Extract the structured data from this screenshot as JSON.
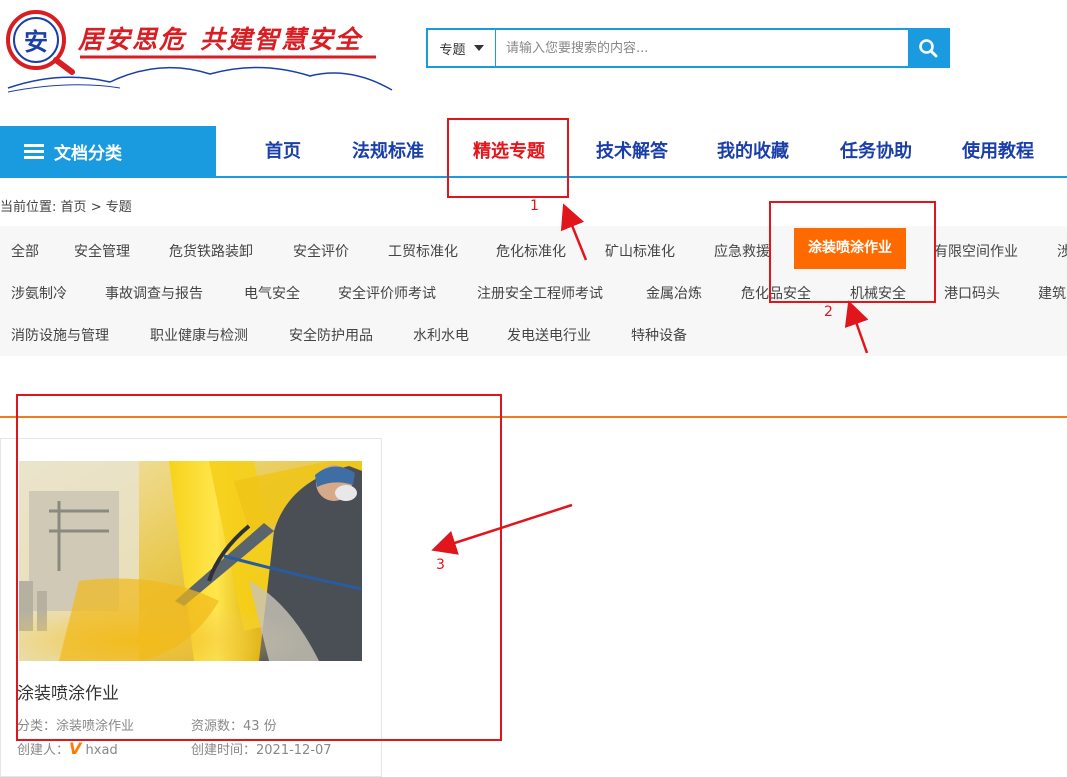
{
  "logo": {
    "seal_char": "安",
    "slogan_part1": "居安思危",
    "slogan_part2": "共建智慧安全"
  },
  "search": {
    "category": "专题",
    "placeholder": "请输入您要搜索的内容..."
  },
  "nav": {
    "doc_category": "文档分类",
    "items": [
      "首页",
      "法规标准",
      "精选专题",
      "技术解答",
      "我的收藏",
      "任务协助",
      "使用教程"
    ],
    "active_index": 2
  },
  "breadcrumb": {
    "prefix": "当前位置:",
    "home": "首页",
    "sep": ">",
    "current": "专题"
  },
  "tags": {
    "row1": [
      "全部",
      "安全管理",
      "危货铁路装卸",
      "安全评价",
      "工贸标准化",
      "危化标准化",
      "矿山标准化",
      "应急救援",
      "涂装喷涂作业",
      "有限空间作业",
      "涉"
    ],
    "row2": [
      "涉氨制冷",
      "事故调查与报告",
      "电气安全",
      "安全评价师考试",
      "注册安全工程师考试",
      "金属冶炼",
      "危化品安全",
      "机械安全",
      "港口码头",
      "建筑"
    ],
    "row3": [
      "消防设施与管理",
      "职业健康与检测",
      "安全防护用品",
      "水利水电",
      "发电送电行业",
      "特种设备"
    ],
    "active": "涂装喷涂作业"
  },
  "card": {
    "title": "涂装喷涂作业",
    "category_label": "分类：",
    "category_value": "涂装喷涂作业",
    "resources_label": "资源数：",
    "resources_value": "43 份",
    "creator_label": "创建人：",
    "creator_badge": "V",
    "creator_value": "hxad",
    "created_label": "创建时间：",
    "created_value": "2021-12-07"
  },
  "annotations": [
    "1",
    "2",
    "3"
  ],
  "colors": {
    "brand_blue": "#1a9be0",
    "nav_text": "#1a3fa8",
    "active_red": "#e5141a",
    "tag_active": "#ff6a00",
    "annotation": "#e1161d"
  }
}
